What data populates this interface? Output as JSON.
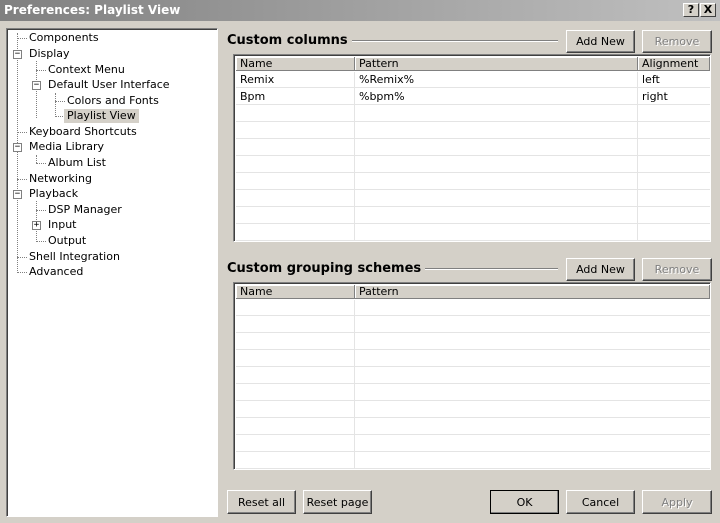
{
  "window": {
    "title": "Preferences: Playlist View",
    "help_button": "?",
    "close_button": "X"
  },
  "tree": {
    "items": [
      {
        "label": "Components"
      },
      {
        "label": "Display"
      },
      {
        "label": "Context Menu"
      },
      {
        "label": "Default User Interface"
      },
      {
        "label": "Colors and Fonts"
      },
      {
        "label": "Playlist View"
      },
      {
        "label": "Keyboard Shortcuts"
      },
      {
        "label": "Media Library"
      },
      {
        "label": "Album List"
      },
      {
        "label": "Networking"
      },
      {
        "label": "Playback"
      },
      {
        "label": "DSP Manager"
      },
      {
        "label": "Input"
      },
      {
        "label": "Output"
      },
      {
        "label": "Shell Integration"
      },
      {
        "label": "Advanced"
      }
    ],
    "selected": "Playlist View",
    "expanded_marker": "−",
    "collapsed_marker": "+"
  },
  "custom_columns": {
    "title": "Custom columns",
    "add_label": "Add New",
    "remove_label": "Remove",
    "headers": [
      "Name",
      "Pattern",
      "Alignment"
    ],
    "rows": [
      [
        "Remix",
        "%Remix%",
        "left"
      ],
      [
        "Bpm",
        "%bpm%",
        "right"
      ]
    ]
  },
  "custom_grouping": {
    "title": "Custom grouping schemes",
    "add_label": "Add New",
    "remove_label": "Remove",
    "headers": [
      "Name",
      "Pattern"
    ],
    "rows": []
  },
  "footer": {
    "reset_all": "Reset all",
    "reset_page": "Reset page",
    "ok": "OK",
    "cancel": "Cancel",
    "apply": "Apply"
  }
}
